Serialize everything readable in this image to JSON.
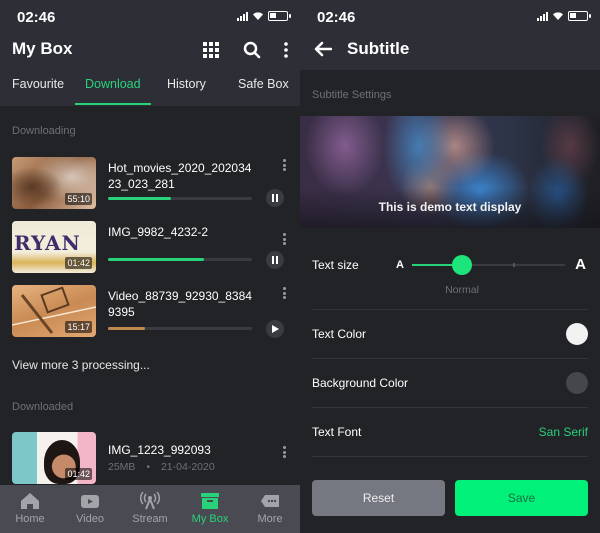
{
  "status_bar": {
    "time": "02:46"
  },
  "mybox": {
    "title": "My Box",
    "tabs": [
      {
        "label": "Favourite",
        "active": false
      },
      {
        "label": "Download",
        "active": true
      },
      {
        "label": "History",
        "active": false
      },
      {
        "label": "Safe Box",
        "active": false
      }
    ],
    "downloading_label": "Downloading",
    "downloading": [
      {
        "name": "Hot_movies_2020_20203423_023_281",
        "duration": "55:10",
        "progress": 0.44,
        "progress_color": "#27d27b",
        "state": "downloading",
        "control_icon": "pause-icon"
      },
      {
        "name": "IMG_9982_4232-2",
        "duration": "01:42",
        "progress": 0.67,
        "progress_color": "#27d27b",
        "state": "downloading",
        "control_icon": "pause-icon"
      },
      {
        "name": "Video_88739_92930_83849395",
        "duration": "15:17",
        "progress": 0.26,
        "progress_color": "#c08a4f",
        "state": "paused",
        "control_icon": "play-icon"
      }
    ],
    "view_more": "View more 3 processing...",
    "downloaded_label": "Downloaded",
    "downloaded": [
      {
        "name": "IMG_1223_992093",
        "duration": "01:42",
        "size": "25MB",
        "separator": "•",
        "date": "21-04-2020"
      }
    ],
    "bottom_nav": [
      {
        "label": "Home",
        "icon": "home-icon",
        "active": false
      },
      {
        "label": "Video",
        "icon": "video-icon",
        "active": false
      },
      {
        "label": "Stream",
        "icon": "stream-icon",
        "active": false
      },
      {
        "label": "My Box",
        "icon": "box-icon",
        "active": true
      },
      {
        "label": "More",
        "icon": "more-icon",
        "active": false
      }
    ]
  },
  "subtitle": {
    "title": "Subtitle",
    "section_label": "Subtitle Settings",
    "demo_text": "This is demo text display",
    "text_size": {
      "label": "Text size",
      "small_glyph": "A",
      "large_glyph": "A",
      "value_label": "Normal",
      "level": 0.33
    },
    "text_color": {
      "label": "Text Color",
      "value": "#f2f2f2"
    },
    "background_color": {
      "label": "Background Color",
      "value": "#46474b"
    },
    "text_font": {
      "label": "Text Font",
      "value": "San Serif"
    },
    "reset_label": "Reset",
    "save_label": "Save"
  },
  "colors": {
    "accent": "#27d27b",
    "save_button": "#00f07a",
    "background": "#222327",
    "header": "#2e2f36"
  }
}
